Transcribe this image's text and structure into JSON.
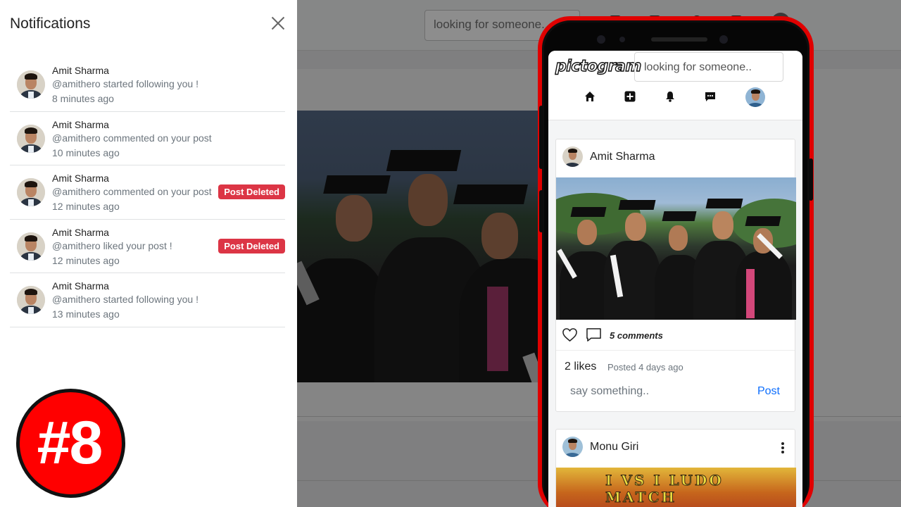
{
  "background_page": {
    "search_placeholder": "looking for someone.."
  },
  "notifications": {
    "title": "Notifications",
    "items": [
      {
        "name": "Amit Sharma",
        "text": "@amithero started following you !",
        "time": "8 minutes ago",
        "badge": ""
      },
      {
        "name": "Amit Sharma",
        "text": "@amithero commented on your post",
        "time": "10 minutes ago",
        "badge": ""
      },
      {
        "name": "Amit Sharma",
        "text": "@amithero commented on your post",
        "time": "12 minutes ago",
        "badge": "Post Deleted"
      },
      {
        "name": "Amit Sharma",
        "text": "@amithero liked your post !",
        "time": "12 minutes ago",
        "badge": "Post Deleted"
      },
      {
        "name": "Amit Sharma",
        "text": "@amithero started following you !",
        "time": "13 minutes ago",
        "badge": ""
      }
    ]
  },
  "episode": {
    "label": "#8",
    "color": "#ff0000"
  },
  "phone": {
    "brand": "pictogram",
    "search_placeholder": "looking for someone..",
    "nav_icons": [
      "home-icon",
      "add-post-icon",
      "bell-icon",
      "message-icon"
    ],
    "posts": [
      {
        "author": "Amit Sharma",
        "comments": "5 comments",
        "likes": "2 likes",
        "posted": "Posted 4 days ago",
        "comment_placeholder": "say something..",
        "post_button": "Post"
      },
      {
        "author": "Monu Giri",
        "image_text": "I VS I LUDO MATCH"
      }
    ]
  },
  "colors": {
    "badge_red": "#dc3545",
    "link_blue": "#0d6efd",
    "phone_outline": "#e00000"
  }
}
